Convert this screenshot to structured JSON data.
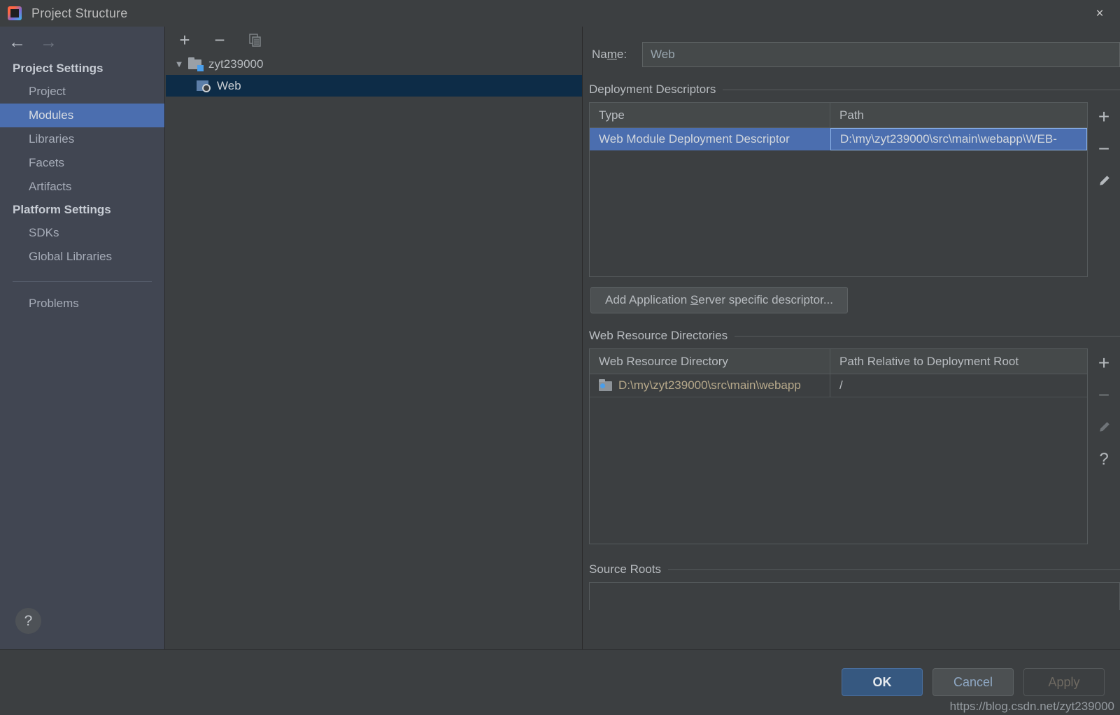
{
  "window": {
    "title": "Project Structure",
    "icon": "intellij-logo-icon",
    "close_label": "×"
  },
  "sidebar": {
    "back_label": "←",
    "forward_label": "→",
    "groups": [
      {
        "title": "Project Settings",
        "items": [
          {
            "label": "Project",
            "selected": false
          },
          {
            "label": "Modules",
            "selected": true
          },
          {
            "label": "Libraries",
            "selected": false
          },
          {
            "label": "Facets",
            "selected": false
          },
          {
            "label": "Artifacts",
            "selected": false
          }
        ]
      },
      {
        "title": "Platform Settings",
        "items": [
          {
            "label": "SDKs",
            "selected": false
          },
          {
            "label": "Global Libraries",
            "selected": false
          }
        ]
      }
    ],
    "extra_items": [
      {
        "label": "Problems",
        "selected": false
      }
    ],
    "help_label": "?",
    "selected_color": "#4b6eaf"
  },
  "tree": {
    "toolbar": [
      {
        "name": "add-module-button",
        "label": "+",
        "enabled": true
      },
      {
        "name": "remove-module-button",
        "label": "−",
        "enabled": true
      },
      {
        "name": "copy-module-button",
        "label": "copy-icon",
        "enabled": false
      }
    ],
    "nodes": [
      {
        "label": "zyt239000",
        "icon": "project-folder-icon",
        "depth": 0,
        "expanded": true,
        "selected": false,
        "triangle": "▼"
      },
      {
        "label": "Web",
        "icon": "web-module-icon",
        "depth": 1,
        "expanded": false,
        "selected": true,
        "triangle": ""
      }
    ],
    "selected_color": "#0d2c47"
  },
  "main": {
    "name_field": {
      "label_before": "Na",
      "label_mnemonic": "m",
      "label_after": "e:",
      "value": "Web",
      "placeholder": ""
    },
    "deployment_descriptors": {
      "title": "Deployment Descriptors",
      "columns": [
        "Type",
        "Path"
      ],
      "rows": [
        {
          "type": "Web Module Deployment Descriptor",
          "path": "D:\\my\\zyt239000\\src\\main\\webapp\\WEB-",
          "selected": true
        }
      ],
      "toolbar": [
        {
          "name": "add-descriptor-button",
          "label": "+",
          "enabled": true
        },
        {
          "name": "remove-descriptor-button",
          "label": "−",
          "enabled": true
        },
        {
          "name": "edit-descriptor-button",
          "label": "pencil-icon",
          "enabled": true
        }
      ],
      "add_server_button": {
        "before": "Add Application ",
        "mnemonic": "S",
        "after": "erver specific descriptor..."
      }
    },
    "web_resource_directories": {
      "title": "Web Resource Directories",
      "columns": [
        "Web Resource Directory",
        "Path Relative to Deployment Root"
      ],
      "rows": [
        {
          "directory": "D:\\my\\zyt239000\\src\\main\\webapp",
          "relative_path": "/",
          "icon": "web-resource-folder-icon",
          "selected": false
        }
      ],
      "toolbar": [
        {
          "name": "add-resource-dir-button",
          "label": "+",
          "enabled": true
        },
        {
          "name": "remove-resource-dir-button",
          "label": "−",
          "enabled": false
        },
        {
          "name": "edit-resource-dir-button",
          "label": "pencil-icon",
          "enabled": false
        },
        {
          "name": "resource-dir-help-button",
          "label": "?",
          "enabled": true
        }
      ]
    },
    "source_roots": {
      "title": "Source Roots"
    }
  },
  "footer": {
    "ok_label": "OK",
    "cancel_label": "Cancel",
    "apply_label": "Apply",
    "apply_enabled": false,
    "ok_color": "#365880"
  },
  "watermark": "https://blog.csdn.net/zyt239000"
}
